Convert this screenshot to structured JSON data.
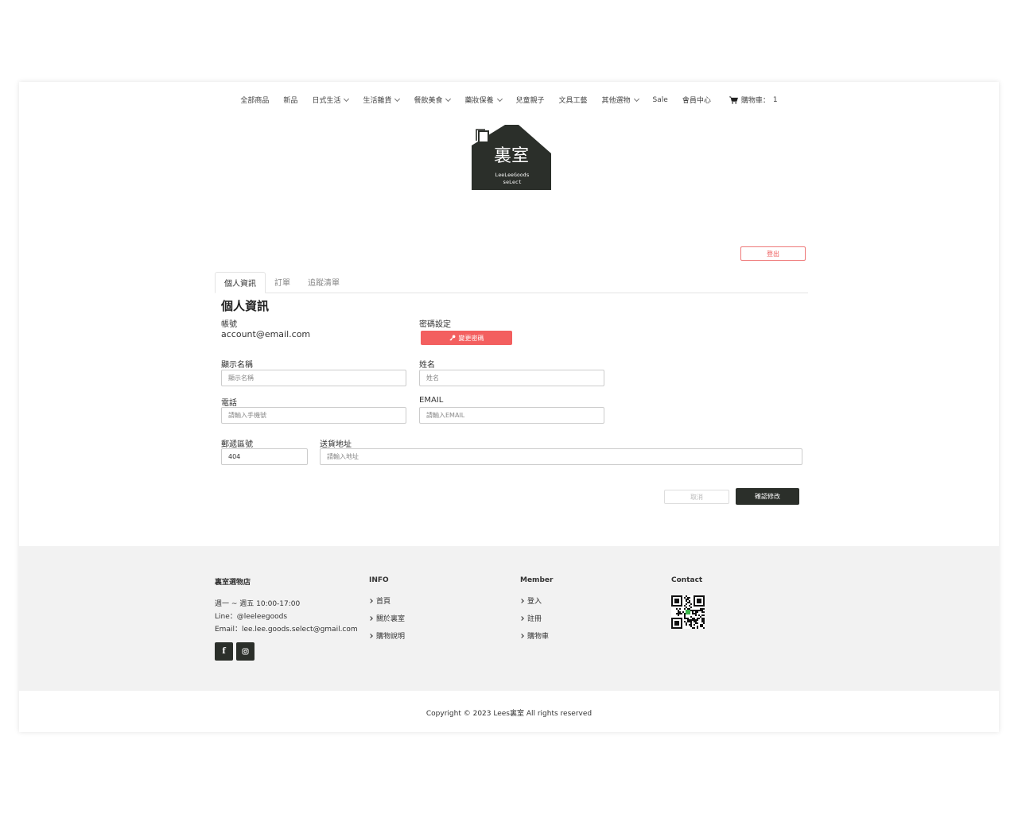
{
  "nav": {
    "items": [
      {
        "label": "全部商品",
        "dropdown": false
      },
      {
        "label": "新品",
        "dropdown": false
      },
      {
        "label": "日式生活",
        "dropdown": true
      },
      {
        "label": "生活雜貨",
        "dropdown": true
      },
      {
        "label": "餐飲美食",
        "dropdown": true
      },
      {
        "label": "藥妝保養",
        "dropdown": true
      },
      {
        "label": "兒童親子",
        "dropdown": false
      },
      {
        "label": "文具工藝",
        "dropdown": false
      },
      {
        "label": "其他選物",
        "dropdown": true
      },
      {
        "label": "Sale",
        "dropdown": false
      },
      {
        "label": "會員中心",
        "dropdown": false
      }
    ],
    "cart_label": "購物車：",
    "cart_count": "1"
  },
  "logo": {
    "chars": "裏室",
    "line1": "LeeLeeGoods",
    "line2": "seLect",
    "color": "#2b2f2a"
  },
  "logout_label": "登出",
  "tabs": [
    {
      "label": "個人資訊",
      "active": true
    },
    {
      "label": "訂單",
      "active": false
    },
    {
      "label": "追蹤清單",
      "active": false
    }
  ],
  "profile": {
    "title": "個人資訊",
    "account_label": "帳號",
    "account_value": "account@email.com",
    "password_label": "密碼設定",
    "change_password_label": "變更密碼",
    "display_name_label": "顯示名稱",
    "display_name_placeholder": "顯示名稱",
    "name_label": "姓名",
    "name_placeholder": "姓名",
    "phone_label": "電話",
    "phone_placeholder": "請輸入手機號",
    "email_label": "EMAIL",
    "email_placeholder": "請輸入EMAIL",
    "zip_label": "郵遞區號",
    "zip_value": "404",
    "address_label": "送貨地址",
    "address_placeholder": "請輸入地址",
    "cancel_label": "取消",
    "confirm_label": "確認修改"
  },
  "footer": {
    "store_name": "裏室選物店",
    "hours": "週一 ~ 週五 10:00-17:00",
    "line": "Line：@leeleegoods",
    "email": "Email：lee.lee.goods.select@gmail.com",
    "info_head": "INFO",
    "info_links": [
      "首頁",
      "關於裏室",
      "購物說明"
    ],
    "member_head": "Member",
    "member_links": [
      "登入",
      "註冊",
      "購物車"
    ],
    "contact_head": "Contact",
    "copyright": "Copyright © 2023 Lees裏室 All rights reserved"
  },
  "colors": {
    "accent": "#f35f5f",
    "dark": "#2b2f2a",
    "footer_bg": "#f2f2f2"
  }
}
